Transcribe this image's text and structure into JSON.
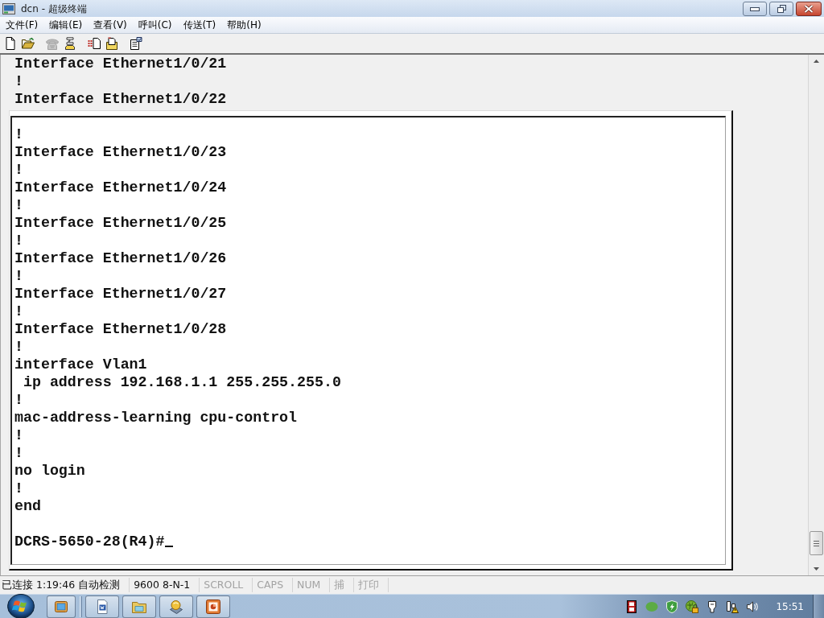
{
  "window": {
    "title": "dcn - 超级终端"
  },
  "menu": [
    "文件(F)",
    "编辑(E)",
    "查看(V)",
    "呼叫(C)",
    "传送(T)",
    "帮助(H)"
  ],
  "toolbar": {
    "groups": [
      [
        {
          "kind": "new",
          "disabled": false
        },
        {
          "kind": "open",
          "disabled": false
        }
      ],
      [
        {
          "kind": "call",
          "disabled": true
        },
        {
          "kind": "hangup",
          "disabled": false
        }
      ],
      [
        {
          "kind": "send",
          "disabled": false
        },
        {
          "kind": "receive",
          "disabled": false
        }
      ],
      [
        {
          "kind": "properties",
          "disabled": false
        }
      ]
    ]
  },
  "terminal": {
    "lines": [
      "Interface Ethernet1/0/21",
      "!",
      "Interface Ethernet1/0/22"
    ],
    "framed_lines": [
      "!",
      "Interface Ethernet1/0/23",
      "!",
      "Interface Ethernet1/0/24",
      "!",
      "Interface Ethernet1/0/25",
      "!",
      "Interface Ethernet1/0/26",
      "!",
      "Interface Ethernet1/0/27",
      "!",
      "Interface Ethernet1/0/28",
      "!",
      "interface Vlan1",
      " ip address 192.168.1.1 255.255.255.0",
      "!",
      "mac-address-learning cpu-control",
      "!",
      "!",
      "no login",
      "!",
      "end"
    ],
    "prompt": "DCRS-5650-28(R4)#",
    "cursor": true
  },
  "status_bar": {
    "panes": [
      {
        "text": "已连接 1:19:46 自动检测",
        "active": true
      },
      {
        "text": "9600 8-N-1",
        "active": true
      },
      {
        "text": "SCROLL",
        "active": false
      },
      {
        "text": "CAPS",
        "active": false
      },
      {
        "text": "NUM",
        "active": false
      },
      {
        "text": "捕",
        "active": false
      },
      {
        "text": "打印",
        "active": false
      }
    ]
  },
  "taskbar": {
    "buttons": [
      {
        "kind": "app"
      },
      {
        "kind": "document"
      },
      {
        "kind": "folder"
      },
      {
        "kind": "device"
      },
      {
        "kind": "slide"
      }
    ],
    "tray": [
      {
        "kind": "film"
      },
      {
        "kind": "blob"
      },
      {
        "kind": "shield"
      },
      {
        "kind": "globe-lock"
      },
      {
        "kind": "plug"
      },
      {
        "kind": "network-warning"
      },
      {
        "kind": "speaker"
      }
    ],
    "clock": "15:51"
  }
}
